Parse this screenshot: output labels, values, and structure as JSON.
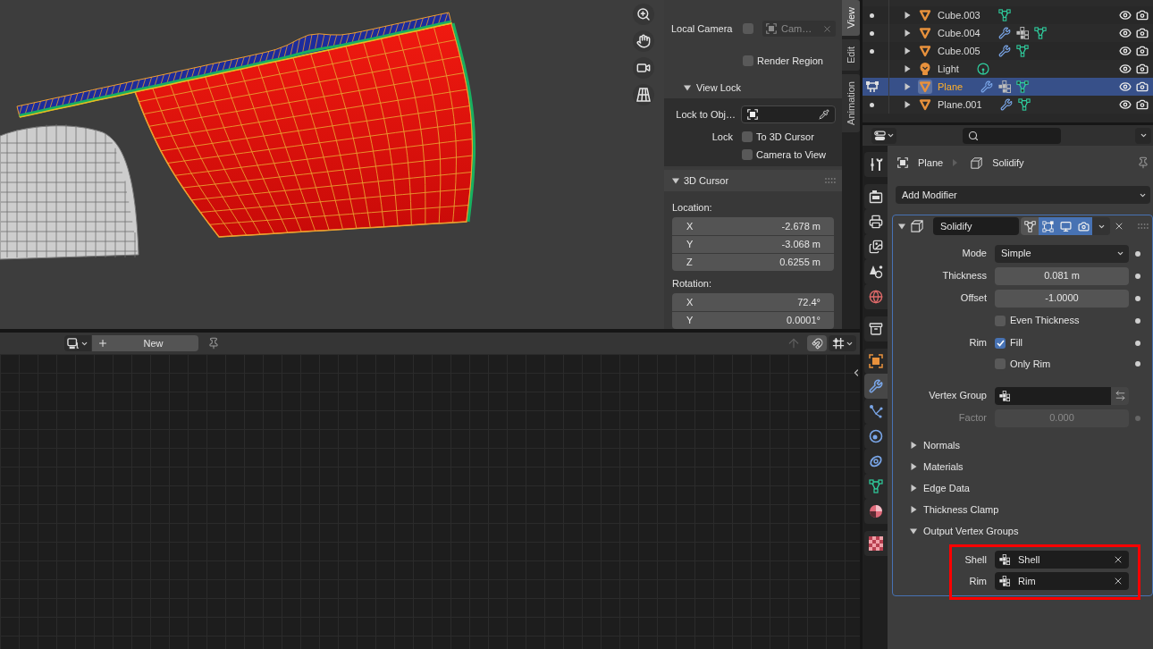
{
  "sidebar": {
    "tabs": [
      {
        "label": "View",
        "selected": true
      },
      {
        "label": "Edit",
        "selected": false
      },
      {
        "label": "Animation",
        "selected": false
      }
    ],
    "local_camera": {
      "label": "Local Camera",
      "checked": false,
      "value": "Cam…"
    },
    "render_region": {
      "label": "Render Region",
      "checked": false
    },
    "view_lock": {
      "title": "View Lock",
      "expanded": true,
      "lock_to_object": {
        "label": "Lock to Obj…"
      },
      "lock": {
        "label": "Lock",
        "options": [
          {
            "label": "To 3D Cursor",
            "checked": false
          },
          {
            "label": "Camera to View",
            "checked": false
          }
        ]
      }
    },
    "cursor": {
      "title": "3D Cursor",
      "expanded": true,
      "groups": [
        {
          "label": "Location:",
          "fields": [
            {
              "axis": "X",
              "value": "-2.678 m"
            },
            {
              "axis": "Y",
              "value": "-3.068 m"
            },
            {
              "axis": "Z",
              "value": "0.6255 m"
            }
          ]
        },
        {
          "label": "Rotation:",
          "fields": [
            {
              "axis": "X",
              "value": "72.4°"
            },
            {
              "axis": "Y",
              "value": "0.0001°"
            }
          ]
        }
      ]
    }
  },
  "node_editor": {
    "new_button": "New"
  },
  "outliner": {
    "rows": [
      {
        "name": "Cube.003",
        "kind": "mesh",
        "mode_toggle": {
          "kind": "dot"
        },
        "selected": false,
        "badges": [
          {
            "kind": "mesh"
          }
        ]
      },
      {
        "name": "Cube.004",
        "kind": "mesh",
        "mode_toggle": {
          "kind": "dot"
        },
        "selected": false,
        "badges": [
          {
            "kind": "modifier"
          },
          {
            "kind": "vertex_groups"
          },
          {
            "kind": "mesh"
          }
        ]
      },
      {
        "name": "Cube.005",
        "kind": "mesh",
        "mode_toggle": {
          "kind": "dot"
        },
        "selected": false,
        "badges": [
          {
            "kind": "modifier"
          },
          {
            "kind": "mesh"
          }
        ]
      },
      {
        "name": "Light",
        "kind": "light",
        "selected": false,
        "badges": [
          {
            "kind": "light"
          }
        ]
      },
      {
        "name": "Plane",
        "kind": "mesh",
        "mode_toggle": {
          "kind": "figure"
        },
        "selected": true,
        "badges": [
          {
            "kind": "modifier"
          },
          {
            "kind": "vertex_groups"
          },
          {
            "kind": "mesh"
          }
        ]
      },
      {
        "name": "Plane.001",
        "kind": "mesh",
        "mode_toggle": {
          "kind": "dot"
        },
        "selected": false,
        "badges": [
          {
            "kind": "modifier"
          },
          {
            "kind": "mesh"
          }
        ]
      }
    ]
  },
  "properties": {
    "tab_groups": [
      [
        {
          "kind": "tool",
          "selected": false
        }
      ],
      [
        {
          "kind": "render",
          "selected": false
        },
        {
          "kind": "output",
          "selected": false
        },
        {
          "kind": "view_layer",
          "selected": false
        },
        {
          "kind": "scene",
          "selected": false
        },
        {
          "kind": "world",
          "selected": false
        }
      ],
      [
        {
          "kind": "collection",
          "selected": false
        }
      ],
      [
        {
          "kind": "object",
          "selected": false
        },
        {
          "kind": "modifiers",
          "selected": true
        },
        {
          "kind": "particles",
          "selected": false
        },
        {
          "kind": "physics",
          "selected": false
        },
        {
          "kind": "constraints",
          "selected": false
        },
        {
          "kind": "data",
          "selected": false
        },
        {
          "kind": "material",
          "selected": false
        }
      ],
      [
        {
          "kind": "texture",
          "selected": false
        }
      ]
    ],
    "breadcrumb": {
      "object": "Plane",
      "modifier": "Solidify"
    },
    "add_modifier": "Add Modifier",
    "modifier": {
      "name": "Solidify",
      "expanded": true,
      "toggles": [
        {
          "kind": "edit_mode",
          "on": false
        },
        {
          "kind": "cage",
          "on": true
        },
        {
          "kind": "viewport",
          "on": true
        },
        {
          "kind": "render",
          "on": true
        }
      ],
      "rows": [
        {
          "kind": "dropdown",
          "label": "Mode",
          "value": "Simple",
          "disabled": false
        },
        {
          "kind": "number",
          "label": "Thickness",
          "value": "0.081 m",
          "disabled": false
        },
        {
          "kind": "number",
          "label": "Offset",
          "value": "-1.0000",
          "disabled": false
        },
        {
          "kind": "checkbox",
          "option": "Even Thickness",
          "checked": false,
          "disabled": false
        },
        {
          "kind": "checkbox",
          "label": "Rim",
          "option": "Fill",
          "checked": true,
          "disabled": false
        },
        {
          "kind": "checkbox",
          "option": "Only Rim",
          "checked": false,
          "disabled": false
        },
        {
          "kind": "vertex_group",
          "label": "Vertex Group",
          "disabled": false
        },
        {
          "kind": "number",
          "label": "Factor",
          "value": "0.000",
          "disabled": true
        }
      ],
      "subpanels": [
        {
          "title": "Normals",
          "expanded": false
        },
        {
          "title": "Materials",
          "expanded": false
        },
        {
          "title": "Edge Data",
          "expanded": false
        },
        {
          "title": "Thickness Clamp",
          "expanded": false
        },
        {
          "title": "Output Vertex Groups",
          "expanded": true,
          "fields": [
            {
              "label": "Shell",
              "value": "Shell"
            },
            {
              "label": "Rim",
              "value": "Rim"
            }
          ]
        }
      ]
    }
  }
}
